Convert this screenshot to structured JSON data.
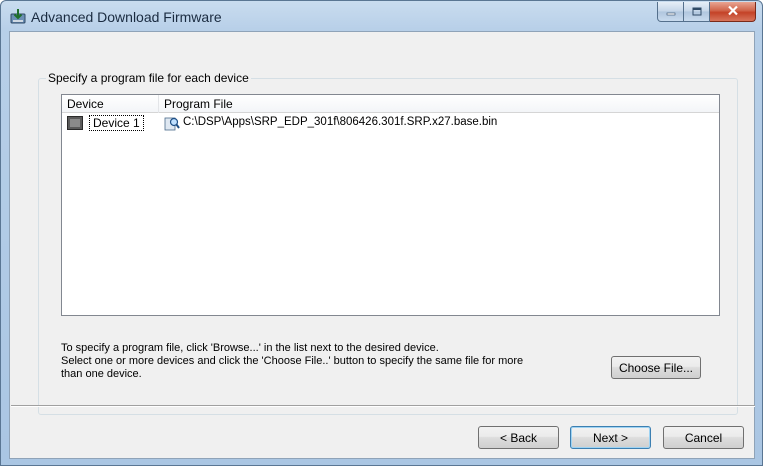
{
  "window": {
    "title": "Advanced Download Firmware"
  },
  "groupbox": {
    "title": "Specify a program file for each device"
  },
  "listview": {
    "columns": [
      "Device",
      "Program File"
    ],
    "rows": [
      {
        "device": "Device 1",
        "file": "C:\\DSP\\Apps\\SRP_EDP_301f\\806426.301f.SRP.x27.base.bin",
        "device_icon": "chip-icon",
        "file_icon": "browse-icon"
      }
    ]
  },
  "help": {
    "line1": "To specify a program file, click 'Browse...' in the list next to the desired device.",
    "line2": "Select one or more devices and click the 'Choose File..' button to specify the same file for more",
    "line3": "than one device."
  },
  "buttons": {
    "choose_file": "Choose File...",
    "back": "< Back",
    "next": "Next >",
    "cancel": "Cancel"
  },
  "caption_buttons": {
    "minimize_icon": "minimize-icon",
    "maximize_icon": "maximize-icon",
    "close_icon": "close-icon"
  }
}
